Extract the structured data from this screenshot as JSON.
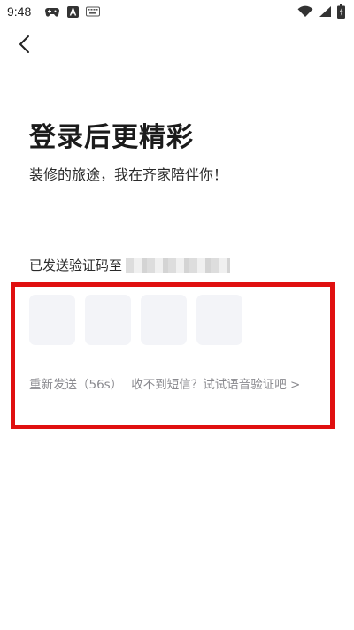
{
  "status_bar": {
    "time": "9:48",
    "left_icons": [
      "gamepad-icon",
      "a-badge-icon",
      "keyboard-icon"
    ],
    "right_icons": [
      "wifi-icon",
      "signal-icon",
      "battery-charging-icon"
    ]
  },
  "header": {
    "back_icon": "chevron-left-icon"
  },
  "main": {
    "title": "登录后更精彩",
    "subtitle": "装修的旅途，我在齐家陪伴你！",
    "code_sent_label": "已发送验证码至",
    "otp_slots": 4,
    "resend_label": "重新发送（56s）",
    "voice_prompt": "收不到短信？试试语音验证吧 >"
  },
  "colors": {
    "highlight": "#e01010",
    "otp_background": "#f3f4f8",
    "hint_text": "#8a8a8f"
  }
}
